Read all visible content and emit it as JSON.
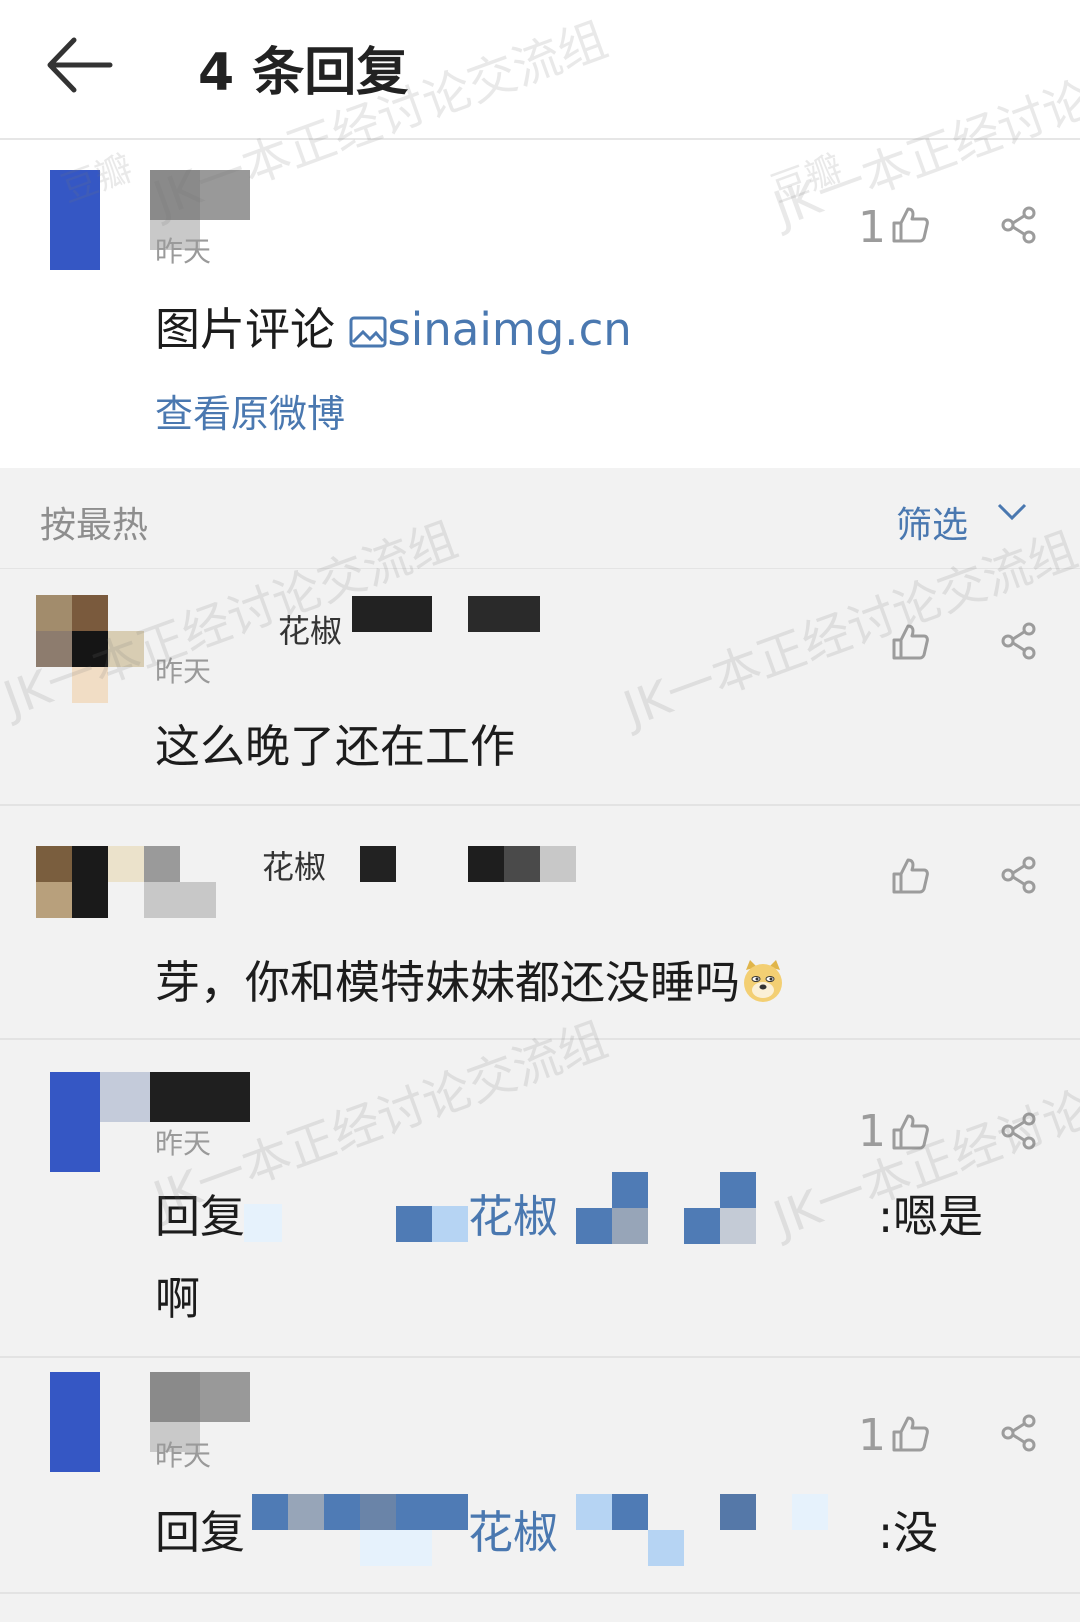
{
  "header": {
    "title": "4 条回复"
  },
  "post": {
    "time": "昨天",
    "likes": "1",
    "text": "图片评论 ",
    "link_label": "sinaimg.cn",
    "view_original": "查看原微博"
  },
  "sort": {
    "label": "按最热",
    "filter_label": "筛选"
  },
  "replies": [
    {
      "name": "花椒",
      "time": "昨天",
      "likes": "",
      "text": "这么晚了还在工作"
    },
    {
      "name": "花椒",
      "time": "",
      "likes": "",
      "text": "芽，你和模特妹妹都还没睡吗"
    },
    {
      "name": "",
      "time": "昨天",
      "likes": "1",
      "text_prefix": "回复",
      "mention": "花椒",
      "text_suffix": ":嗯是",
      "text_line2": "啊"
    },
    {
      "name": "",
      "time": "昨天",
      "likes": "1",
      "text_prefix": "回复",
      "mention": "花椒",
      "text_suffix": ":没"
    }
  ],
  "watermark": {
    "text": "JK一本正经讨论交流组",
    "badge": "豆瓣"
  },
  "colors": {
    "accent": "#4a78b0",
    "avatar_blue": "#3557c4"
  }
}
